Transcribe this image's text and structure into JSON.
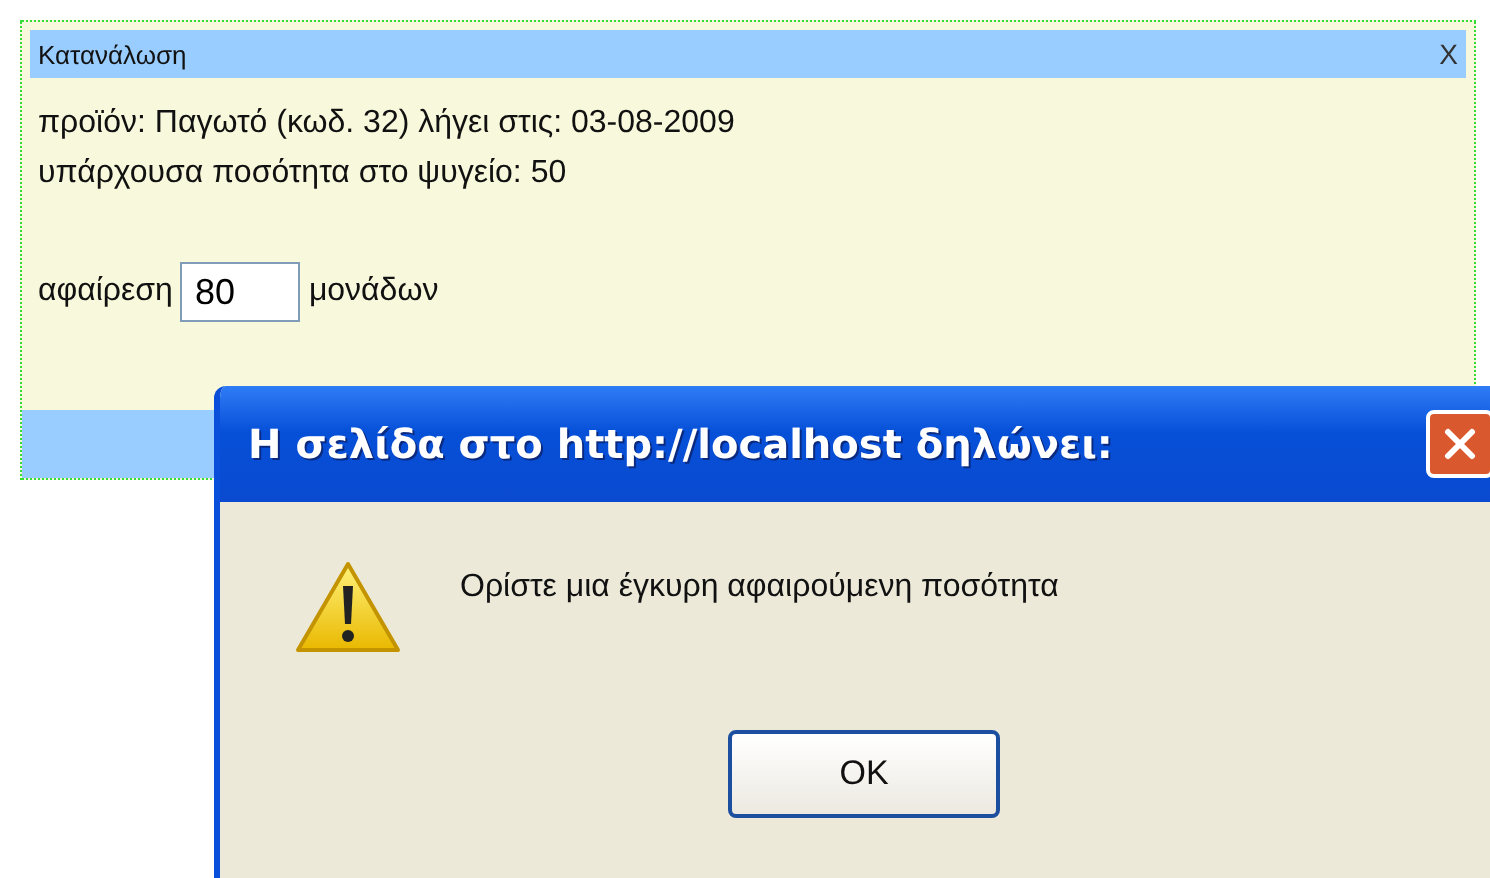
{
  "panel": {
    "title": "Κατανάλωση",
    "close": "X",
    "lines": [
      "προϊόν: Παγωτό (κωδ. 32) λήγει στις: 03-08-2009",
      "υπάρχουσα ποσότητα στο ψυγείο: 50"
    ],
    "remove_label": "αφαίρεση",
    "remove_value": "80",
    "units_label": "μονάδων"
  },
  "dialog": {
    "title": "Η σελίδα στο http://localhost δηλώνει:",
    "message": "Ορίστε μια έγκυρη αφαιρούμενη ποσότητα",
    "button": "OK"
  }
}
